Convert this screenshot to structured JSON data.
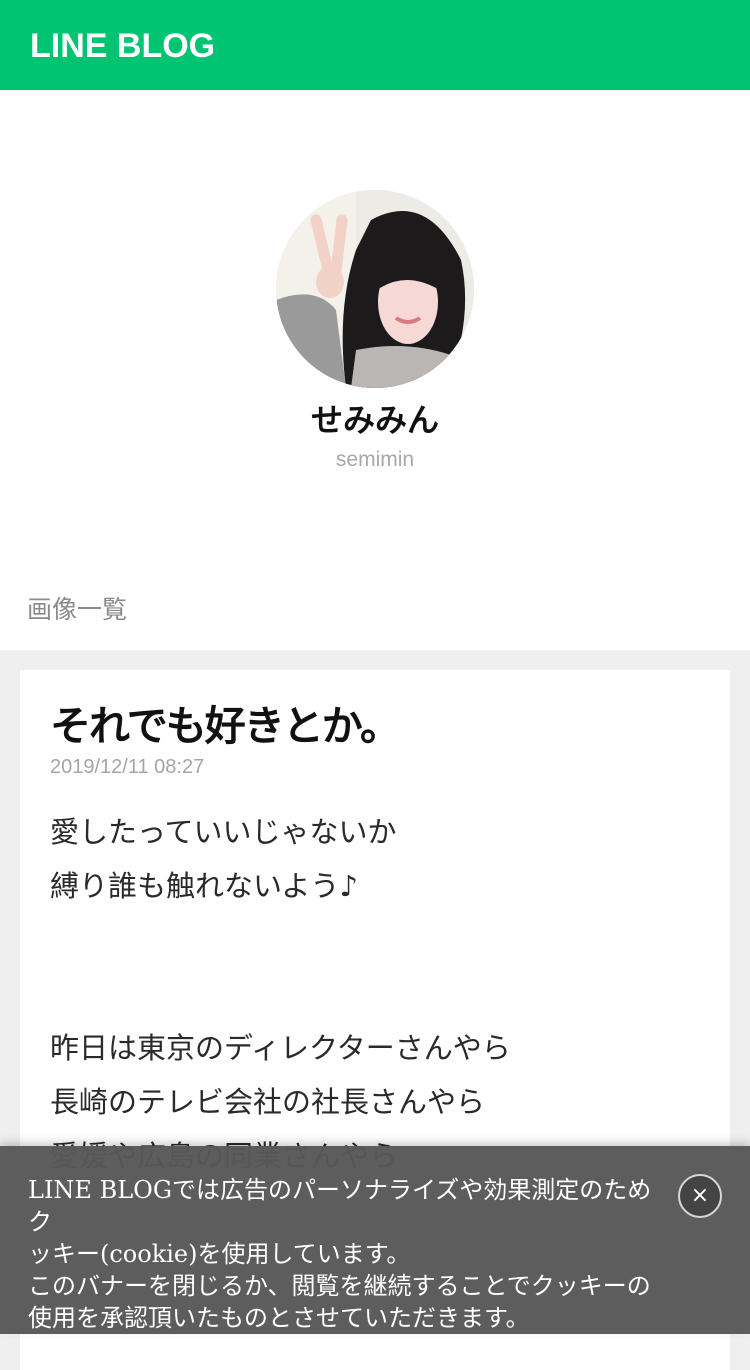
{
  "header": {
    "logo_text": "LINE BLOG"
  },
  "profile": {
    "name": "せみみん",
    "handle": "semimin",
    "images_link": "画像一覧"
  },
  "post": {
    "title": "それでも好きとか。",
    "date": "2019/12/11 08:27",
    "lines": [
      "愛したっていいじゃないか",
      "縛り誰も触れないよう♪",
      "昨日は東京のディレクターさんやら",
      "長崎のテレビ会社の社長さんやら",
      "愛媛や広島の同業さんやら"
    ]
  },
  "cookie_banner": {
    "text_lines": [
      "LINE BLOGでは広告のパーソナライズや効果測定のためク",
      "ッキー(cookie)を使用しています。",
      "このバナーを閉じるか、閲覧を継続することでクッキーの",
      "使用を承認頂いたものとさせていただきます。"
    ],
    "close_label": "×"
  },
  "colors": {
    "brand": "#00c472",
    "banner_bg": "#585858"
  }
}
